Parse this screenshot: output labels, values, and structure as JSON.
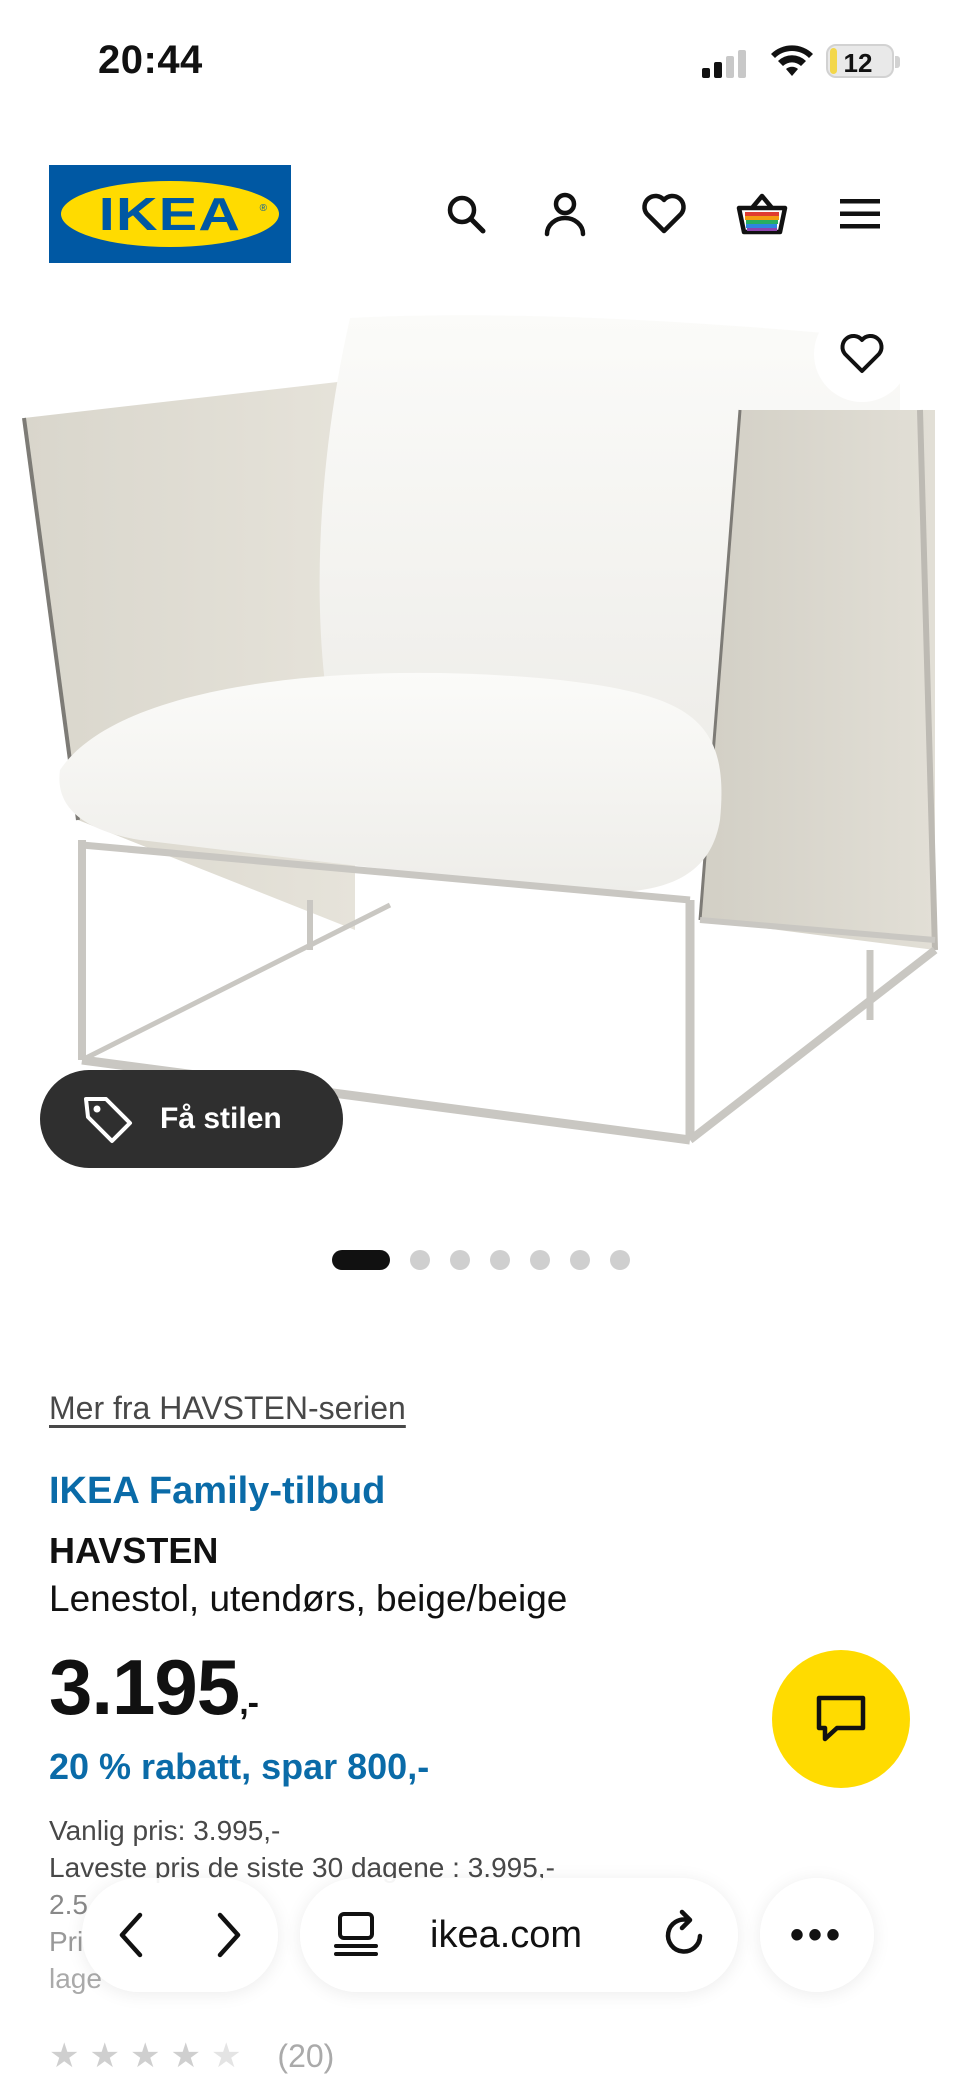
{
  "status_bar": {
    "time": "20:44",
    "battery": "12",
    "battery_level": 0.12,
    "signal_bars": 2
  },
  "header": {
    "logo_text": "IKEA",
    "icons": [
      "search-icon",
      "account-icon",
      "heart-icon",
      "cart-icon",
      "menu-icon"
    ]
  },
  "product_image": {
    "style_button_label": "Få stilen",
    "carousel_count": 7,
    "carousel_active": 1
  },
  "product": {
    "series_link": "Mer fra HAVSTEN-serien",
    "family_offer": "IKEA Family-tilbud",
    "name": "HAVSTEN",
    "description": "Lenestol, utendørs, beige/beige",
    "price": "3.195",
    "price_suffix": ",-",
    "discount": "20 % rabatt, spar 800,-",
    "regular_price": "Vanlig pris: 3.995,-",
    "lowest_price": "Laveste pris de siste 30 dagene : 3.995,-",
    "partial_line_1": "2.5",
    "partial_line_2": "Pri",
    "partial_line_3": "lage",
    "rating_stars": 4,
    "rating_count": "(20)"
  },
  "browser": {
    "url": "ikea.com",
    "more_label": "•••"
  },
  "colors": {
    "ikea_blue": "#0058a3",
    "ikea_yellow": "#ffdb00",
    "offer_blue": "#0a6ba8"
  }
}
